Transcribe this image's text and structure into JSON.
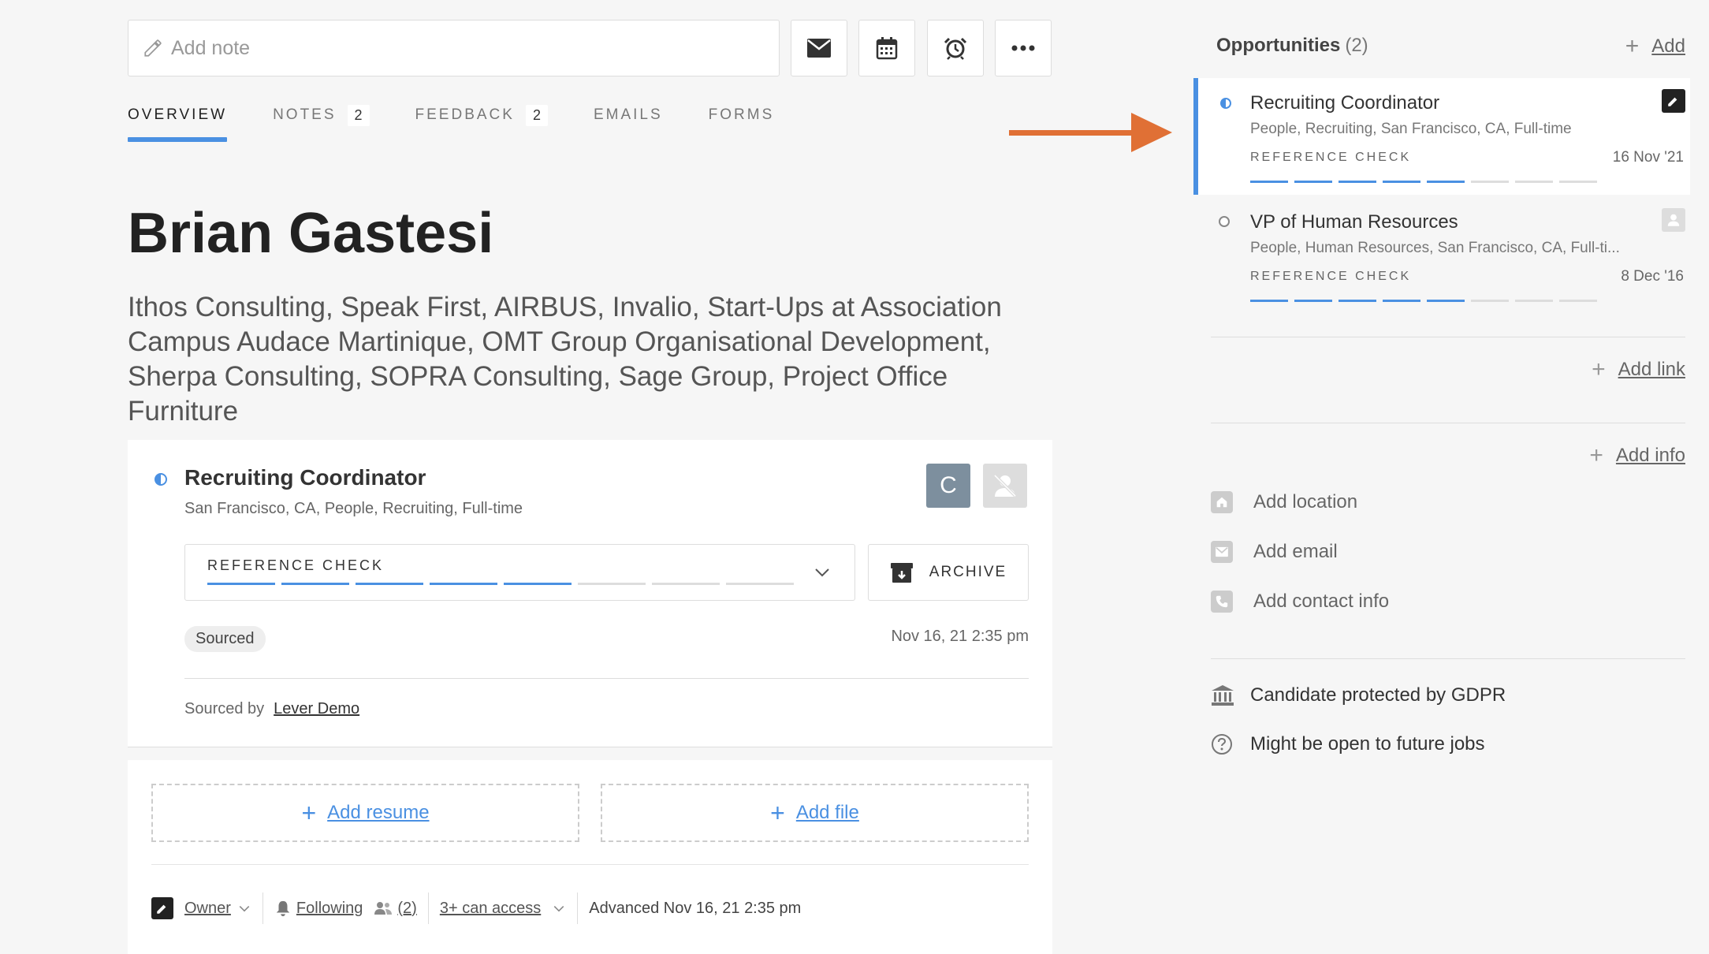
{
  "toolbar": {
    "note_placeholder": "Add note",
    "icons": [
      "envelope-icon",
      "calendar-icon",
      "alarm-clock-icon",
      "more-icon"
    ]
  },
  "tabs": [
    {
      "label": "OVERVIEW",
      "badge": null,
      "active": true
    },
    {
      "label": "NOTES",
      "badge": "2"
    },
    {
      "label": "FEEDBACK",
      "badge": "2"
    },
    {
      "label": "EMAILS",
      "badge": null
    },
    {
      "label": "FORMS",
      "badge": null
    }
  ],
  "candidate": {
    "name": "Brian Gastesi",
    "companies": "Ithos Consulting, Speak First, AIRBUS, Invalio, Start-Ups at Association Campus Audace Martinique, OMT Group Organisational Development, Sherpa Consulting, SOPRA Consulting, Sage Group, Project Office Furniture"
  },
  "opportunity": {
    "title": "Recruiting Coordinator",
    "subtitle": "San Francisco, CA, People, Recruiting, Full-time",
    "avatar_initial": "C",
    "stage": "REFERENCE CHECK",
    "stage_progress": {
      "completed": 5,
      "total": 8
    },
    "archive_label": "ARCHIVE",
    "source_tag": "Sourced",
    "date": "Nov 16, 21 2:35 pm",
    "sourced_by_label": "Sourced by",
    "sourced_by_name": "Lever Demo"
  },
  "files": {
    "add_resume": "Add resume",
    "add_file": "Add file"
  },
  "footer": {
    "owner": "Owner",
    "following": "Following",
    "followers_count": "(2)",
    "access": "3+ can access",
    "advanced": "Advanced Nov 16, 21 2:35 pm"
  },
  "right_panel": {
    "title": "Opportunities",
    "count": "(2)",
    "add_label": "Add",
    "opportunities": [
      {
        "title": "Recruiting Coordinator",
        "subtitle": "People, Recruiting, San Francisco, CA, Full-time",
        "stage": "REFERENCE CHECK",
        "date": "16 Nov '21",
        "progress": {
          "completed": 5,
          "total": 8
        }
      },
      {
        "title": "VP of Human Resources",
        "subtitle": "People, Human Resources, San Francisco, CA, Full-ti...",
        "stage": "REFERENCE CHECK",
        "date": "8 Dec '16",
        "progress": {
          "completed": 5,
          "total": 8
        }
      }
    ],
    "add_link": "Add link",
    "add_info": "Add info",
    "info_items": [
      {
        "label": "Add location",
        "icon": "home-icon"
      },
      {
        "label": "Add email",
        "icon": "envelope-icon"
      },
      {
        "label": "Add contact info",
        "icon": "phone-icon"
      }
    ],
    "gdpr": "Candidate protected by GDPR",
    "future_jobs": "Might be open to future jobs"
  },
  "colors": {
    "accent": "#4a90e2",
    "arrow": "#e07035"
  }
}
